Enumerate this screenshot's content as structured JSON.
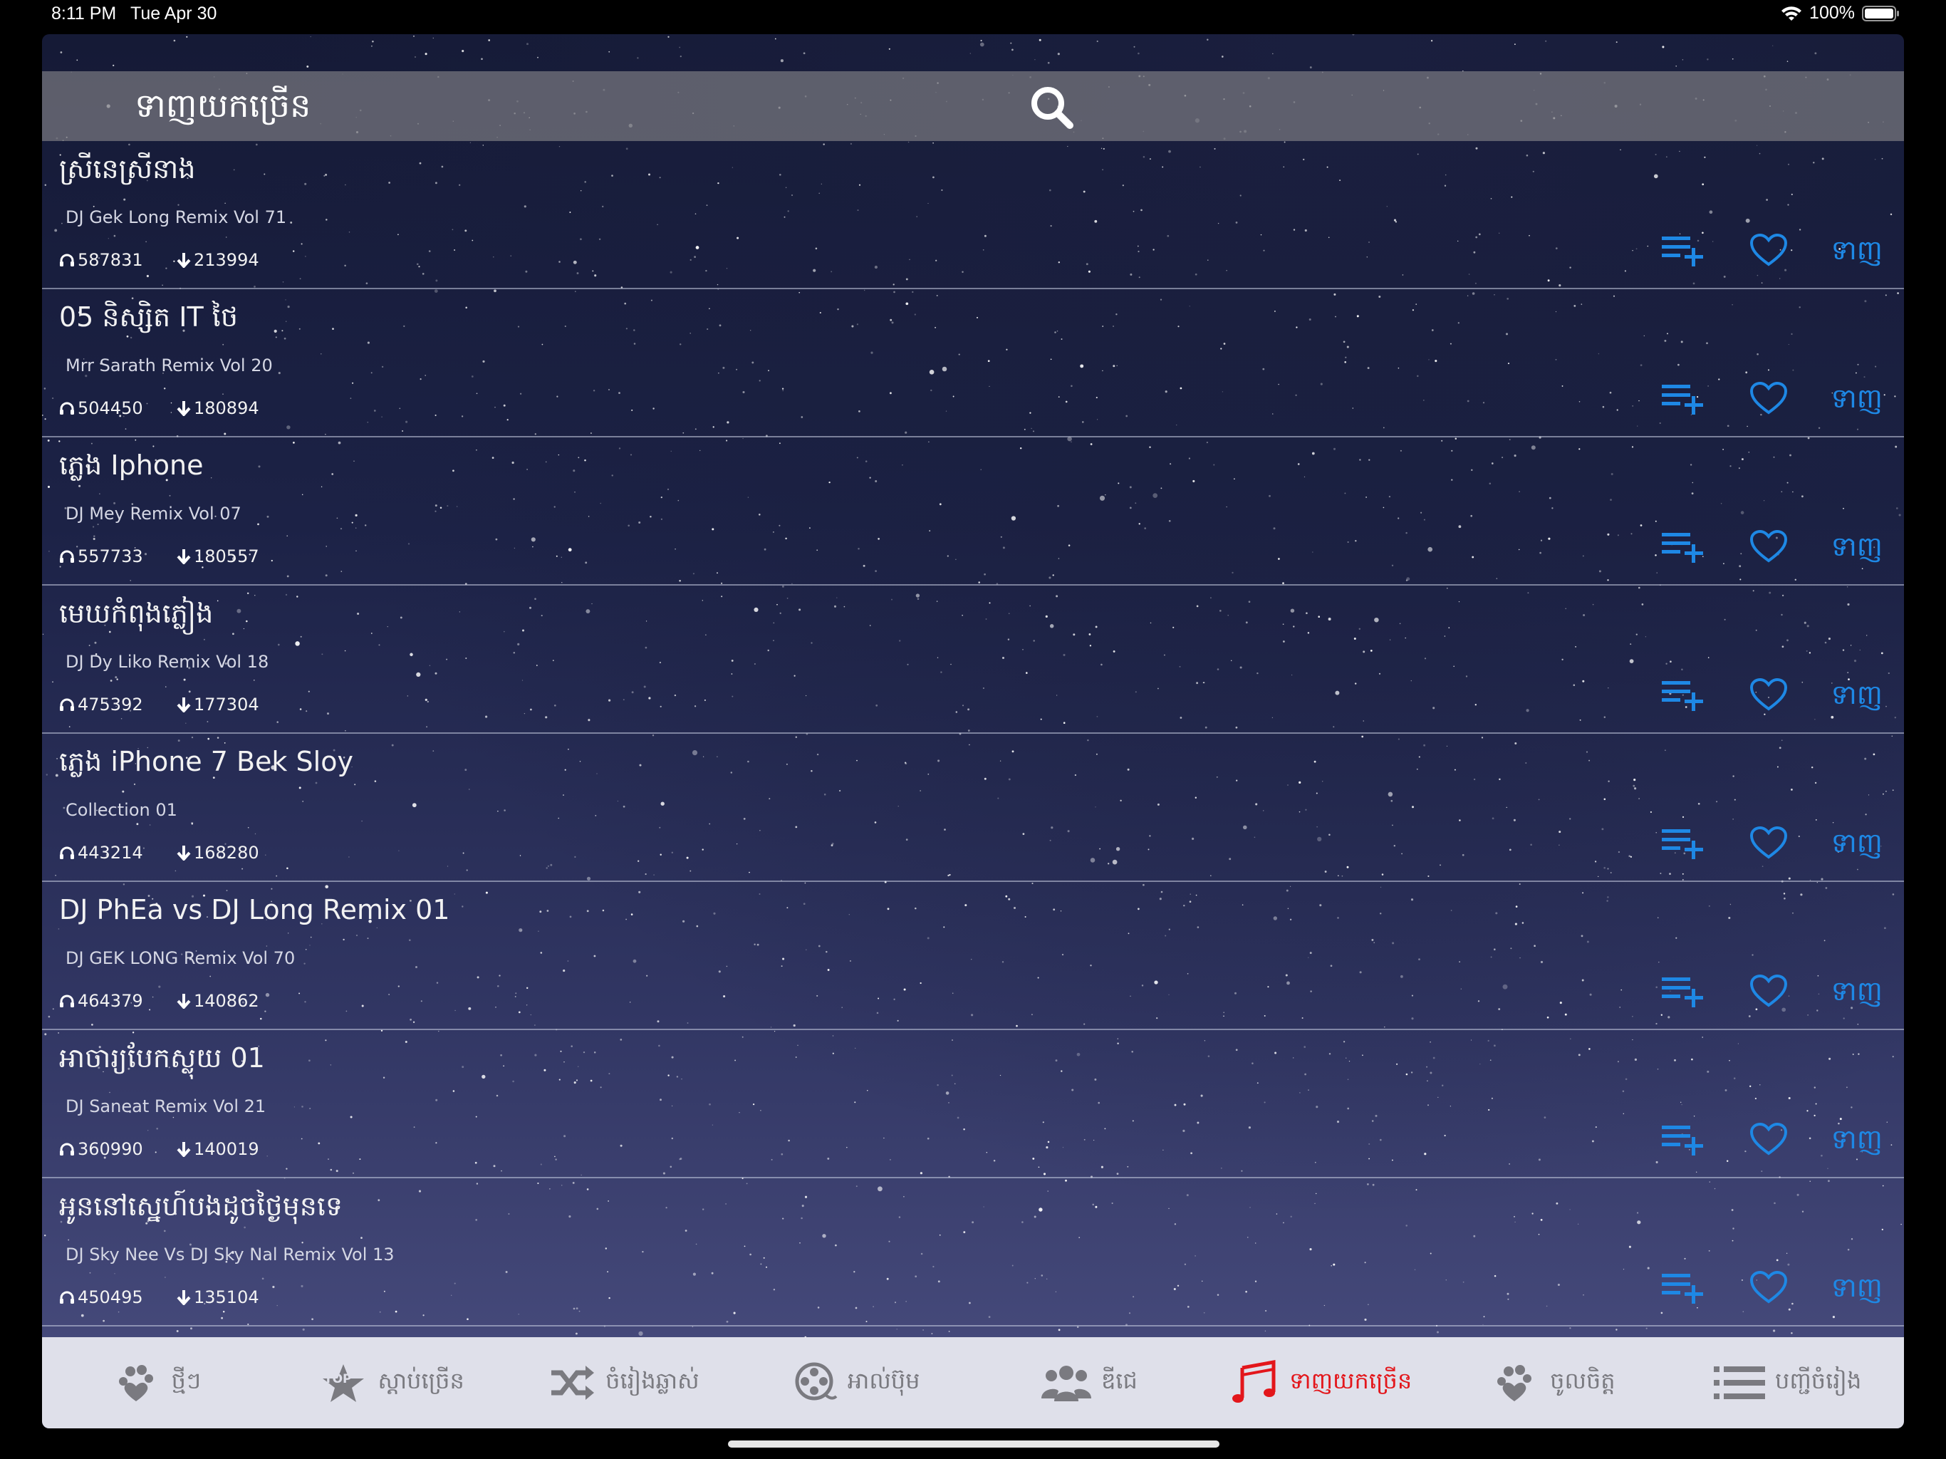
{
  "status_bar": {
    "time": "8:11 PM",
    "date": "Tue Apr 30",
    "battery": "100%",
    "icons": [
      "wifi-icon",
      "battery-icon"
    ]
  },
  "header": {
    "title": "ទាញយកច្រើន",
    "search_icon": "search-icon"
  },
  "songs": [
    {
      "title": "ស្រីនេស្រីនាង",
      "artist": "DJ Gek Long Remix Vol 71",
      "plays": "587831",
      "downloads": "213994",
      "download_label": "ទាញ"
    },
    {
      "title": "05 និស្សិត IT ថៃ",
      "artist": "Mrr Sarath Remix Vol 20",
      "plays": "504450",
      "downloads": "180894",
      "download_label": "ទាញ"
    },
    {
      "title": "ភ្លេង Iphone",
      "artist": "DJ Mey Remix Vol 07",
      "plays": "557733",
      "downloads": "180557",
      "download_label": "ទាញ"
    },
    {
      "title": "មេឃកំពុងភ្លៀង",
      "artist": "DJ Dy Liko Remix Vol 18",
      "plays": "475392",
      "downloads": "177304",
      "download_label": "ទាញ"
    },
    {
      "title": "ភ្លេង iPhone 7 Bek Sloy",
      "artist": "Collection 01",
      "plays": "443214",
      "downloads": "168280",
      "download_label": "ទាញ"
    },
    {
      "title": "DJ PhEa vs DJ Long Remix 01",
      "artist": "DJ GEK LONG Remix Vol 70",
      "plays": "464379",
      "downloads": "140862",
      "download_label": "ទាញ"
    },
    {
      "title": "អាចារ្យបែកស្លុយ 01",
      "artist": "DJ Saneat Remix Vol 21",
      "plays": "360990",
      "downloads": "140019",
      "download_label": "ទាញ"
    },
    {
      "title": "អូននៅស្នេហ៍បងដូចថ្ងៃមុនទេ",
      "artist": "DJ Sky Nee Vs DJ Sky Nal Remix Vol 13",
      "plays": "450495",
      "downloads": "135104",
      "download_label": "ទាញ"
    }
  ],
  "tabs": [
    {
      "label": "ថ្មីៗ",
      "icon": "paw-icon",
      "active": false
    },
    {
      "label": "ស្តាប់ច្រើន",
      "icon": "top-star-icon",
      "active": false
    },
    {
      "label": "ចំរៀងឆ្លាស់",
      "icon": "shuffle-icon",
      "active": false
    },
    {
      "label": "អាល់ប៊ុម",
      "icon": "film-reel-icon",
      "active": false
    },
    {
      "label": "ឌីជេ",
      "icon": "users-icon",
      "active": false
    },
    {
      "label": "ទាញយកច្រើន",
      "icon": "music-notes-icon",
      "active": true
    },
    {
      "label": "ចូលចិត្ត",
      "icon": "paw-icon",
      "active": false
    },
    {
      "label": "បញ្ជីចំរៀង",
      "icon": "list-icon",
      "active": false
    }
  ],
  "colors": {
    "accent_blue": "#1e88e5",
    "active_tab_red": "#e3161b",
    "inactive_tab_gray": "#7a7a80",
    "tabbar_bg": "#dfe0ea",
    "header_bg": "#78787f"
  }
}
